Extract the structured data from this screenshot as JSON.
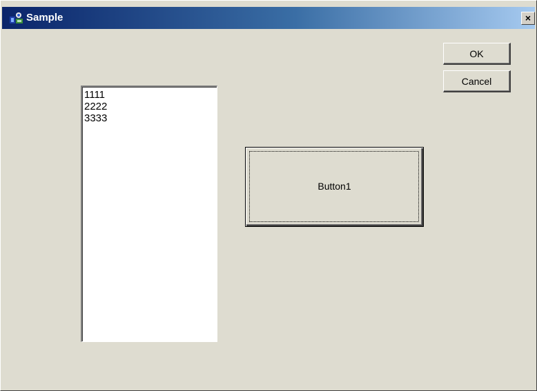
{
  "window": {
    "title": "Sample",
    "close_label": "×"
  },
  "buttons": {
    "ok_label": "OK",
    "cancel_label": "Cancel",
    "button1_label": "Button1"
  },
  "listbox": {
    "items": [
      "1111",
      "2222",
      "3333"
    ]
  },
  "colors": {
    "dialog_background": "#dedcd0",
    "titlebar_start": "#0a246a",
    "titlebar_end": "#a6caf0",
    "listbox_background": "#ffffff"
  },
  "icons": {
    "app": "app-icon",
    "close": "close-icon"
  }
}
